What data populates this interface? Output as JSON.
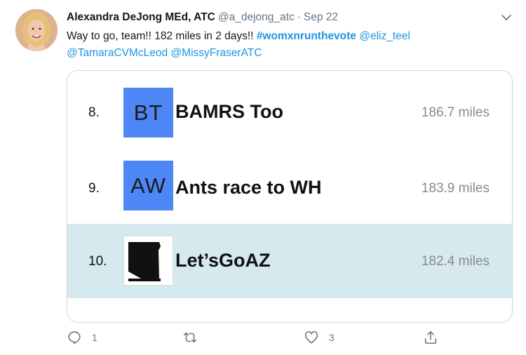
{
  "tweet": {
    "author_name": "Alexandra DeJong MEd, ATC",
    "handle": "@a_dejong_atc",
    "separator": "·",
    "date": "Sep 22",
    "text_plain": "Way to go, team!! 182 miles in 2 days!!",
    "hashtag": "#womxnrunthevote",
    "mention_1": "@eliz_teel",
    "mention_2": "@TamaraCVMcLeod",
    "mention_3": "@MissyFraserATC"
  },
  "leaderboard": {
    "rows": [
      {
        "rank": "8.",
        "badge": "BT",
        "team": "BAMRS Too",
        "miles": "186.7 miles",
        "highlighted": false
      },
      {
        "rank": "9.",
        "badge": "AW",
        "team": "Ants race to WH",
        "miles": "183.9 miles",
        "highlighted": false
      },
      {
        "rank": "10.",
        "badge": "",
        "team": "Let’sGoAZ",
        "miles": "182.4 miles",
        "highlighted": true
      }
    ],
    "badge_color": "#4d86f5",
    "highlight_color": "#d6e9ee"
  },
  "actions": {
    "reply_count": "1",
    "retweet_count": "",
    "like_count": "3",
    "share_count": ""
  },
  "icons": [
    "chevron-down-icon",
    "reply-icon",
    "retweet-icon",
    "like-icon",
    "share-icon"
  ],
  "colors": {
    "link": "#1b95e0",
    "muted": "#657786"
  }
}
